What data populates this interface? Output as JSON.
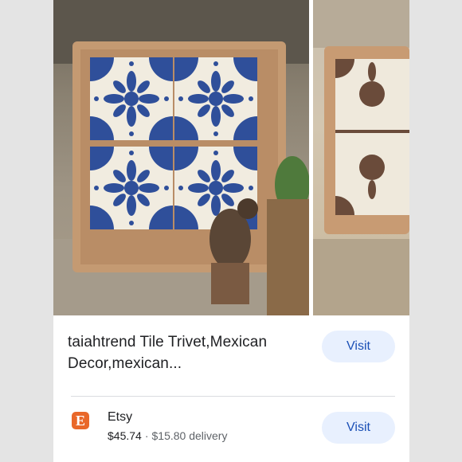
{
  "product": {
    "title_line1": "taiahtrend Tile Trivet,Mexican",
    "title_line2": "Decor,mexican..."
  },
  "actions": {
    "visit_label_top": "Visit",
    "visit_label_bottom": "Visit"
  },
  "seller": {
    "icon_letter": "E",
    "name": "Etsy",
    "price": "$45.74",
    "separator": "·",
    "delivery": "$15.80 delivery"
  },
  "colors": {
    "tile_blue": "#2f4f9a",
    "frame_tan": "#c49a72",
    "store_icon": "#e9682a",
    "button_bg": "#e8f0fe",
    "button_text": "#1a4fb6"
  },
  "icons": {
    "store": "etsy-logo-icon"
  }
}
